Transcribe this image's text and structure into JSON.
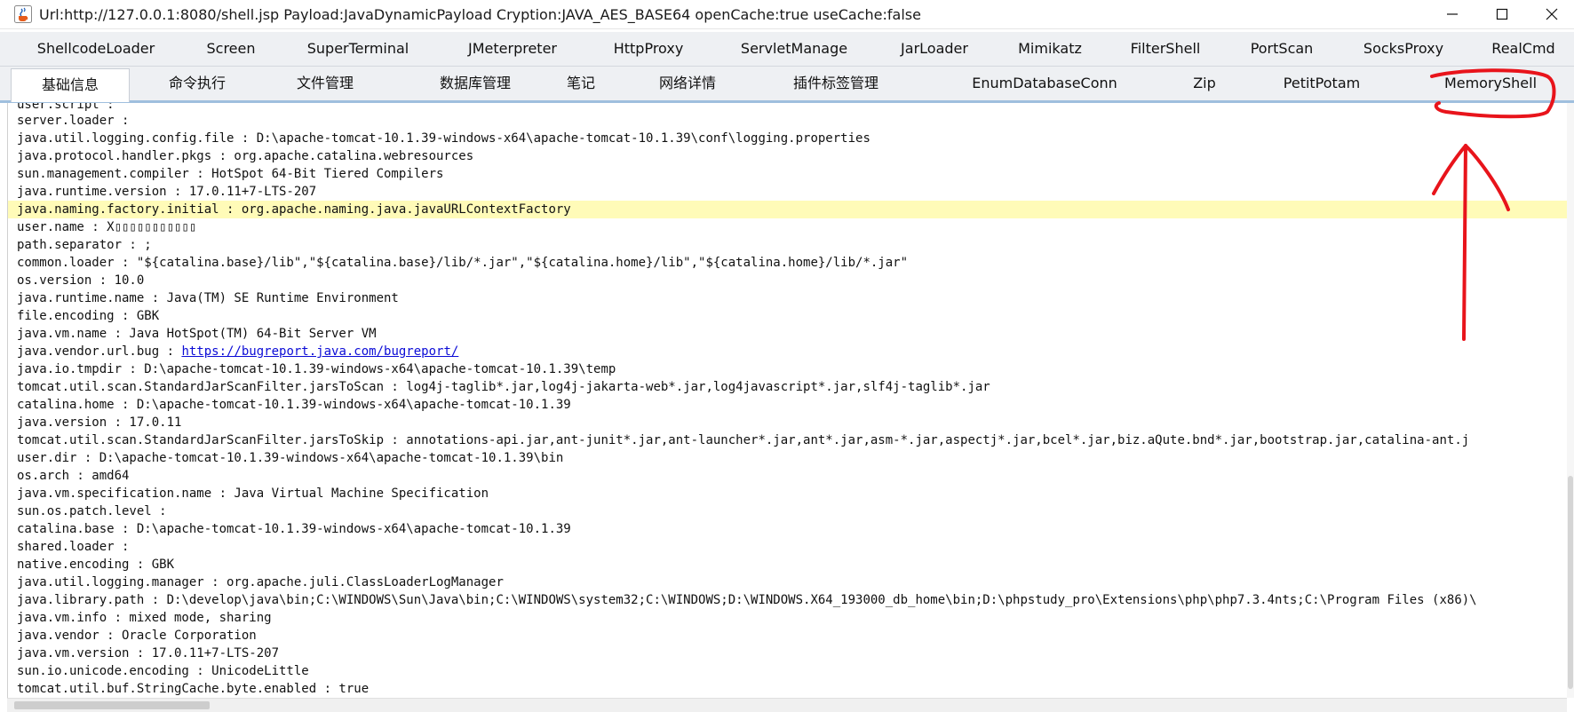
{
  "window": {
    "title": "Url:http://127.0.0.1:8080/shell.jsp Payload:JavaDynamicPayload Cryption:JAVA_AES_BASE64 openCache:true useCache:false",
    "app_icon": "java-coffee-cup-icon",
    "controls": {
      "minimize": "minimize-icon",
      "maximize": "maximize-icon",
      "close": "close-icon"
    }
  },
  "tabs_top": [
    "ShellcodeLoader",
    "Screen",
    "SuperTerminal",
    "JMeterpreter",
    "HttpProxy",
    "ServletManage",
    "JarLoader",
    "Mimikatz",
    "FilterShell",
    "PortScan",
    "SocksProxy",
    "RealCmd"
  ],
  "tabs_bottom": [
    "基础信息",
    "命令执行",
    "文件管理",
    "数据库管理",
    "笔记",
    "网络详情",
    "插件标签管理",
    "EnumDatabaseConn",
    "Zip",
    "PetitPotam",
    "MemoryShell"
  ],
  "selected_tab": "基础信息",
  "info_lines": [
    "server.loader :",
    "java.util.logging.config.file : D:\\apache-tomcat-10.1.39-windows-x64\\apache-tomcat-10.1.39\\conf\\logging.properties",
    "java.protocol.handler.pkgs : org.apache.catalina.webresources",
    "sun.management.compiler : HotSpot 64-Bit Tiered Compilers",
    "java.runtime.version : 17.0.11+7-LTS-207",
    "java.naming.factory.initial : org.apache.naming.java.javaURLContextFactory",
    "user.name : X▯▯▯▯▯▯▯▯▯▯▯",
    "path.separator : ;",
    "common.loader : \"${catalina.base}/lib\",\"${catalina.base}/lib/*.jar\",\"${catalina.home}/lib\",\"${catalina.home}/lib/*.jar\"",
    "os.version : 10.0",
    "java.runtime.name : Java(TM) SE Runtime Environment",
    "file.encoding : GBK",
    "java.vm.name : Java HotSpot(TM) 64-Bit Server VM",
    "java.vendor.url.bug : ",
    "java.io.tmpdir : D:\\apache-tomcat-10.1.39-windows-x64\\apache-tomcat-10.1.39\\temp",
    "tomcat.util.scan.StandardJarScanFilter.jarsToScan : log4j-taglib*.jar,log4j-jakarta-web*.jar,log4javascript*.jar,slf4j-taglib*.jar",
    "catalina.home : D:\\apache-tomcat-10.1.39-windows-x64\\apache-tomcat-10.1.39",
    "java.version : 17.0.11",
    "tomcat.util.scan.StandardJarScanFilter.jarsToSkip : annotations-api.jar,ant-junit*.jar,ant-launcher*.jar,ant*.jar,asm-*.jar,aspectj*.jar,bcel*.jar,biz.aQute.bnd*.jar,bootstrap.jar,catalina-ant.j",
    "user.dir : D:\\apache-tomcat-10.1.39-windows-x64\\apache-tomcat-10.1.39\\bin",
    "os.arch : amd64",
    "java.vm.specification.name : Java Virtual Machine Specification",
    "sun.os.patch.level :",
    "catalina.base : D:\\apache-tomcat-10.1.39-windows-x64\\apache-tomcat-10.1.39",
    "shared.loader :",
    "native.encoding : GBK",
    "java.util.logging.manager : org.apache.juli.ClassLoaderLogManager",
    "java.library.path : D:\\develop\\java\\bin;C:\\WINDOWS\\Sun\\Java\\bin;C:\\WINDOWS\\system32;C:\\WINDOWS;D:\\WINDOWS.X64_193000_db_home\\bin;D:\\phpstudy_pro\\Extensions\\php\\php7.3.4nts;C:\\Program Files (x86)\\",
    "java.vm.info : mixed mode, sharing",
    "java.vendor : Oracle Corporation",
    "java.vm.version : 17.0.11+7-LTS-207",
    "sun.io.unicode.encoding : UnicodeLittle",
    "tomcat.util.buf.StringCache.byte.enabled : true"
  ],
  "bug_link": "https://bugreport.java.com/bugreport/",
  "highlight_color": "#fffbb8",
  "annotation_color": "#e8141b"
}
